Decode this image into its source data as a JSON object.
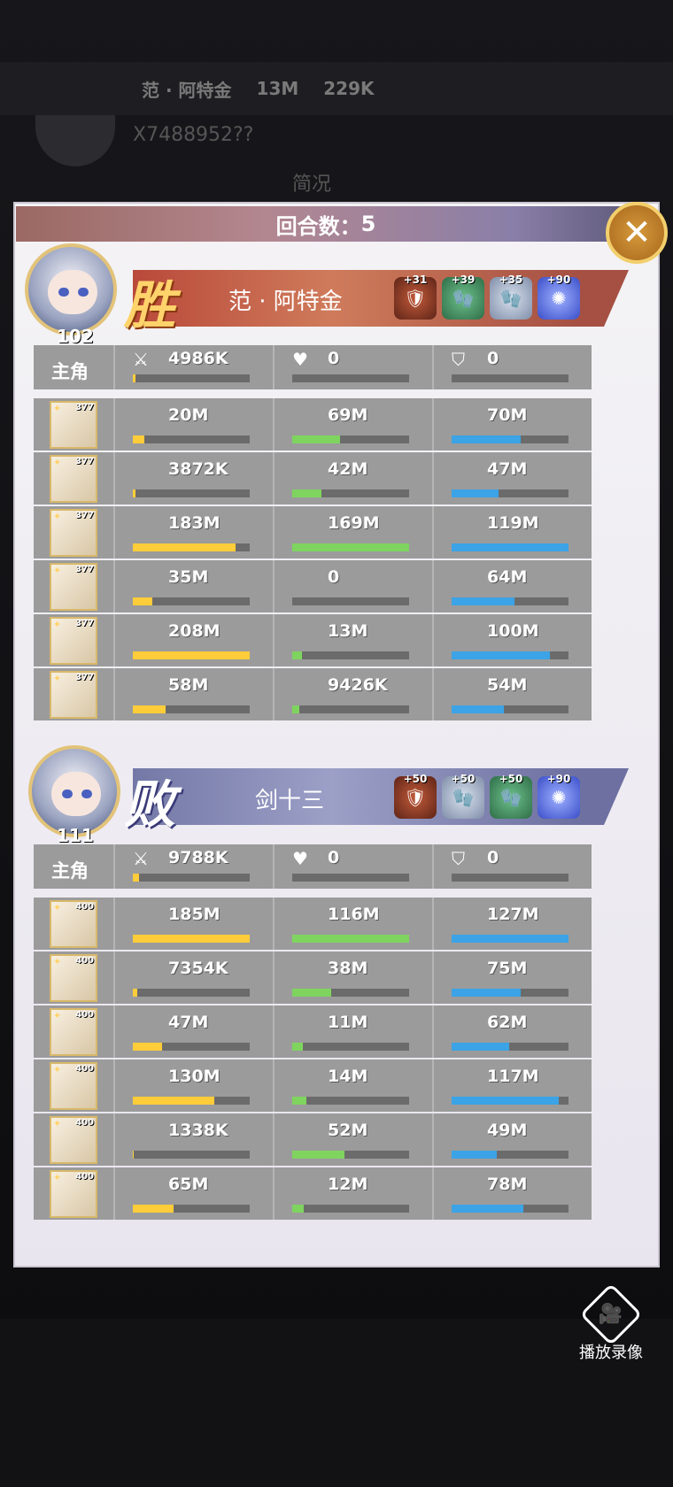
{
  "background": {
    "player_name": "范 · 阿特金",
    "stat_1": "13M",
    "stat_2": "229K",
    "id": "X7488952??",
    "tab": "简况"
  },
  "header": {
    "round_label": "回合数：",
    "round_value": "5"
  },
  "winner": {
    "result": "胜",
    "name": "范 · 阿特金",
    "level": "102",
    "items": [
      {
        "plus": "+31",
        "color": "red",
        "icon": "armor-icon"
      },
      {
        "plus": "+39",
        "color": "green",
        "icon": "gauntlet-icon"
      },
      {
        "plus": "+35",
        "color": "silver",
        "icon": "gauntlet-icon"
      },
      {
        "plus": "+90",
        "color": "blue",
        "icon": "spiral-icon"
      }
    ],
    "main": {
      "label": "主角",
      "damage": "4986K",
      "damage_pct": 2,
      "heal": "0",
      "heal_pct": 0,
      "shield": "0",
      "shield_pct": 0
    },
    "heroes": [
      {
        "level": "377",
        "damage": "20M",
        "damage_pct": 10,
        "heal": "69M",
        "heal_pct": 41,
        "shield": "70M",
        "shield_pct": 59
      },
      {
        "level": "377",
        "damage": "3872K",
        "damage_pct": 2,
        "heal": "42M",
        "heal_pct": 25,
        "shield": "47M",
        "shield_pct": 40
      },
      {
        "level": "377",
        "damage": "183M",
        "damage_pct": 88,
        "heal": "169M",
        "heal_pct": 100,
        "shield": "119M",
        "shield_pct": 100
      },
      {
        "level": "377",
        "damage": "35M",
        "damage_pct": 17,
        "heal": "0",
        "heal_pct": 0,
        "shield": "64M",
        "shield_pct": 54
      },
      {
        "level": "377",
        "damage": "208M",
        "damage_pct": 100,
        "heal": "13M",
        "heal_pct": 8,
        "shield": "100M",
        "shield_pct": 84
      },
      {
        "level": "377",
        "damage": "58M",
        "damage_pct": 28,
        "heal": "9426K",
        "heal_pct": 6,
        "shield": "54M",
        "shield_pct": 45
      }
    ]
  },
  "loser": {
    "result": "败",
    "name": "剑十三",
    "level": "111",
    "items": [
      {
        "plus": "+50",
        "color": "red",
        "icon": "armor-icon"
      },
      {
        "plus": "+50",
        "color": "silver",
        "icon": "gauntlet-icon"
      },
      {
        "plus": "+50",
        "color": "green",
        "icon": "gauntlet-icon"
      },
      {
        "plus": "+90",
        "color": "blue",
        "icon": "spiral-icon"
      }
    ],
    "main": {
      "label": "主角",
      "damage": "9788K",
      "damage_pct": 5,
      "heal": "0",
      "heal_pct": 0,
      "shield": "0",
      "shield_pct": 0
    },
    "heroes": [
      {
        "level": "400",
        "damage": "185M",
        "damage_pct": 100,
        "heal": "116M",
        "heal_pct": 100,
        "shield": "127M",
        "shield_pct": 100
      },
      {
        "level": "400",
        "damage": "7354K",
        "damage_pct": 4,
        "heal": "38M",
        "heal_pct": 33,
        "shield": "75M",
        "shield_pct": 59
      },
      {
        "level": "400",
        "damage": "47M",
        "damage_pct": 25,
        "heal": "11M",
        "heal_pct": 9,
        "shield": "62M",
        "shield_pct": 49
      },
      {
        "level": "400",
        "damage": "130M",
        "damage_pct": 70,
        "heal": "14M",
        "heal_pct": 12,
        "shield": "117M",
        "shield_pct": 92
      },
      {
        "level": "400",
        "damage": "1338K",
        "damage_pct": 1,
        "heal": "52M",
        "heal_pct": 45,
        "shield": "49M",
        "shield_pct": 39
      },
      {
        "level": "400",
        "damage": "65M",
        "damage_pct": 35,
        "heal": "12M",
        "heal_pct": 10,
        "shield": "78M",
        "shield_pct": 61
      }
    ]
  },
  "replay": {
    "label": "播放录像"
  }
}
